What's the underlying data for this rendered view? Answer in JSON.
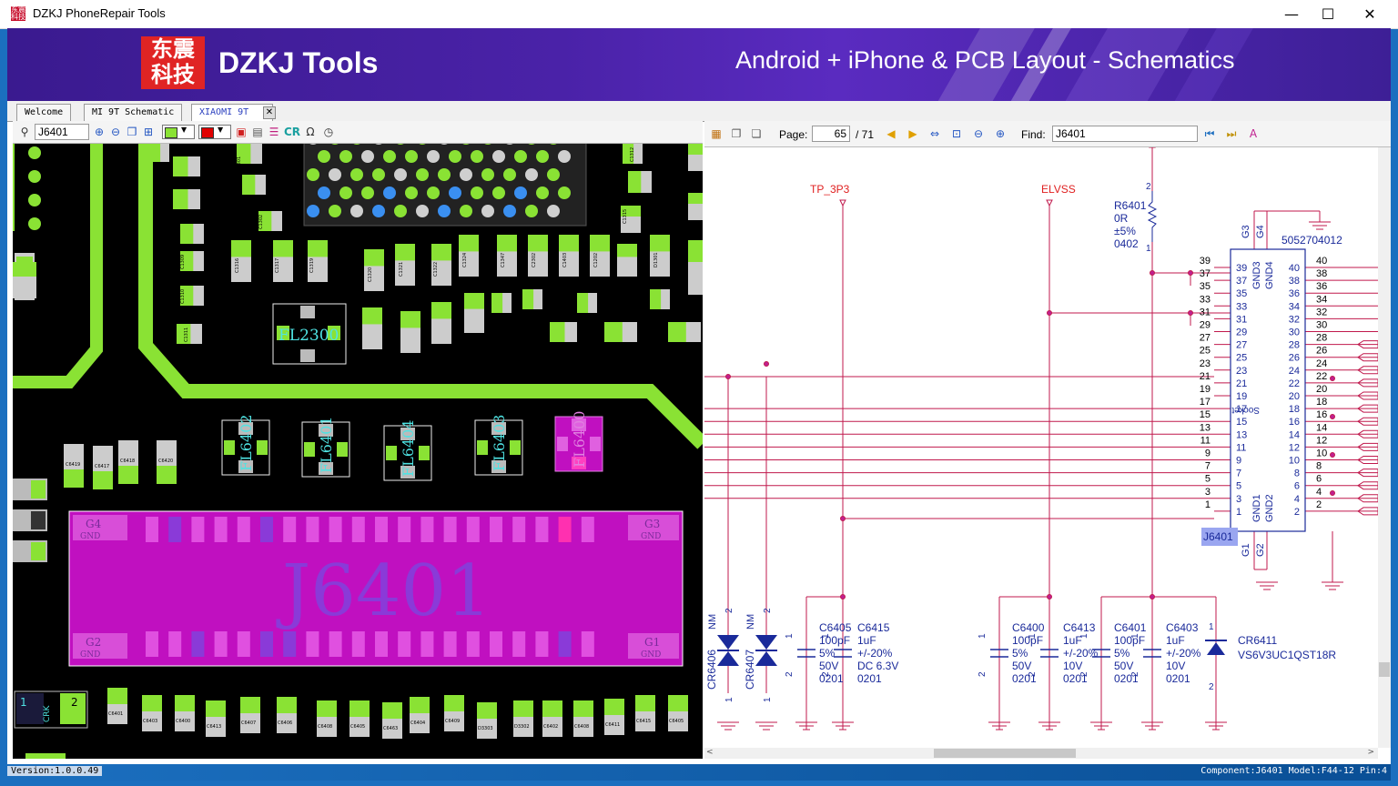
{
  "window": {
    "title": "DZKJ PhoneRepair Tools",
    "icon_text": "东震科技",
    "minimize": "—",
    "maximize": "☐",
    "close": "✕"
  },
  "banner": {
    "logo_line1": "东震",
    "logo_line2": "科技",
    "brand": "DZKJ Tools",
    "tagline": "Android + iPhone & PCB Layout - Schematics"
  },
  "tabs": [
    {
      "label": "Welcome"
    },
    {
      "label": "MI 9T Schematic"
    },
    {
      "label": "XIAOMI 9T"
    }
  ],
  "tab_close": "✕",
  "pcb_toolbar": {
    "search_value": "J6401",
    "cr_label": "CR"
  },
  "sch_toolbar": {
    "page_label": "Page:",
    "page_value": "65",
    "page_total": "/ 71",
    "find_label": "Find:",
    "find_value": "J6401"
  },
  "pcb": {
    "connector_label": "J6401",
    "g1": "G1",
    "g2": "G2",
    "g3": "G3",
    "g4": "G4",
    "gnd": "GND",
    "fl_labels": [
      "FL6402",
      "FL6401",
      "FL6404",
      "FL6403",
      "FL6400"
    ],
    "fl2300": "FL2300",
    "pin1": "1",
    "pin2": "2",
    "crk": "CRK",
    "comp_labels_top": [
      "C1301",
      "C1302",
      "C1309",
      "C1310",
      "C1311",
      "C1312",
      "C1315",
      "C1316",
      "C1317",
      "C1319",
      "C1320",
      "C1321",
      "C1322",
      "C1324",
      "C1347",
      "C2302",
      "C1403",
      "C1202",
      "D1301"
    ],
    "comp_labels_row": [
      "C6419",
      "C6417",
      "C6418",
      "C6420"
    ],
    "comp_labels_bottom": [
      "C6401",
      "C6403",
      "C6400",
      "C6413",
      "C6407",
      "C6406",
      "C6408",
      "C6405",
      "C6463",
      "C6404",
      "C6409",
      "D3303",
      "D3302",
      "C6402",
      "C6408",
      "C6411",
      "C6415",
      "C6405"
    ]
  },
  "schematic": {
    "net_tp3p3": "TP_3P3",
    "net_elvss": "ELVSS",
    "r6401": [
      "R6401",
      "0R",
      "±5%",
      "0402"
    ],
    "r_pin2": "2",
    "r_pin1": "1",
    "connector_part": "5052704012",
    "connector_ref": "J6401",
    "socket_text": "Socket",
    "left_outer_pins": [
      "39",
      "37",
      "35",
      "33",
      "31",
      "29",
      "27",
      "25",
      "23",
      "21",
      "19",
      "17",
      "15",
      "13",
      "11",
      "9",
      "7",
      "5",
      "3",
      "1"
    ],
    "left_inner_pins": [
      "39",
      "37",
      "35",
      "33",
      "31",
      "29",
      "27",
      "25",
      "23",
      "21",
      "19",
      "17",
      "15",
      "13",
      "11",
      "9",
      "7",
      "5",
      "3",
      "1"
    ],
    "right_inner_pins": [
      "40",
      "38",
      "36",
      "34",
      "32",
      "30",
      "28",
      "26",
      "24",
      "22",
      "20",
      "18",
      "16",
      "14",
      "12",
      "10",
      "8",
      "6",
      "4",
      "2"
    ],
    "right_outer_pins": [
      "40",
      "38",
      "36",
      "34",
      "32",
      "30",
      "28",
      "26",
      "24",
      "22",
      "20",
      "18",
      "16",
      "14",
      "12",
      "10",
      "8",
      "6",
      "4",
      "2"
    ],
    "gnd_top": [
      "GND3",
      "GND4"
    ],
    "gnd_bottom": [
      "GND1",
      "GND2"
    ],
    "g_top": [
      "G3",
      "G4"
    ],
    "g_bottom": [
      "G1",
      "G2"
    ],
    "cr6406": {
      "ref": "CR6406",
      "nm": "NM",
      "p2": "2",
      "p1": "1"
    },
    "cr6407": {
      "ref": "CR6407",
      "nm": "NM",
      "p2": "2",
      "p1": "1"
    },
    "c6405": {
      "ref": "C6405",
      "v1": "100pF",
      "v2": "5%",
      "v3": "50V",
      "v4": "0201"
    },
    "c6415": {
      "ref": "C6415",
      "v1": "1uF",
      "v2": "+/-20%",
      "v3": "DC 6.3V",
      "v4": "0201"
    },
    "c6400": {
      "ref": "C6400",
      "v1": "100pF",
      "v2": "5%",
      "v3": "50V",
      "v4": "0201"
    },
    "c6413": {
      "ref": "C6413",
      "v1": "1uF",
      "v2": "+/-20%",
      "v3": "10V",
      "v4": "0201"
    },
    "c6401": {
      "ref": "C6401",
      "v1": "100pF",
      "v2": "5%",
      "v3": "50V",
      "v4": "0201"
    },
    "c6403": {
      "ref": "C6403",
      "v1": "1uF",
      "v2": "+/-20%",
      "v3": "10V",
      "v4": "0201"
    },
    "cr6411": {
      "ref": "CR6411",
      "part": "VS6V3UC1QST18R"
    },
    "cap_pin1": "1",
    "cap_pin2": "2"
  },
  "status": {
    "version": "Version:1.0.0.49",
    "component": "Component:J6401 Model:F44-12 Pin:4"
  },
  "colors": {
    "pcb_bg": "#000000",
    "trace": "#8ae234",
    "connector": "#c010c0",
    "schematic_wire": "#c0184c",
    "schematic_part": "#1a2a9a",
    "net_label": "#e02020"
  }
}
